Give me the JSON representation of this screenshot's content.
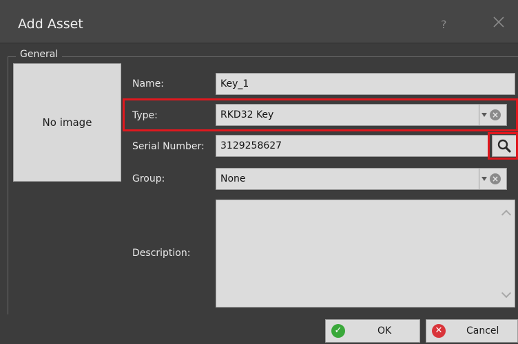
{
  "dialog": {
    "title": "Add Asset",
    "help_label": "?"
  },
  "group": {
    "legend": "General"
  },
  "image": {
    "placeholder": "No image"
  },
  "fields": {
    "name": {
      "label": "Name:",
      "value": "Key_1"
    },
    "type": {
      "label": "Type:",
      "value": "RKD32 Key"
    },
    "serial": {
      "label": "Serial Number:",
      "value": "3129258627"
    },
    "group": {
      "label": "Group:",
      "value": "None"
    },
    "description": {
      "label": "Description:",
      "value": ""
    }
  },
  "icons": {
    "dropdown": "chevron-down-icon",
    "clear": "clear-icon",
    "search": "search-icon",
    "close": "close-icon"
  },
  "buttons": {
    "ok": {
      "label": "OK",
      "icon": "check-icon",
      "color": "#3aa83a"
    },
    "cancel": {
      "label": "Cancel",
      "icon": "cancel-icon",
      "color": "#d9343a"
    }
  },
  "colors": {
    "highlight": "#e0181e",
    "background": "#3c3c3c",
    "field": "#dcdcdc"
  }
}
